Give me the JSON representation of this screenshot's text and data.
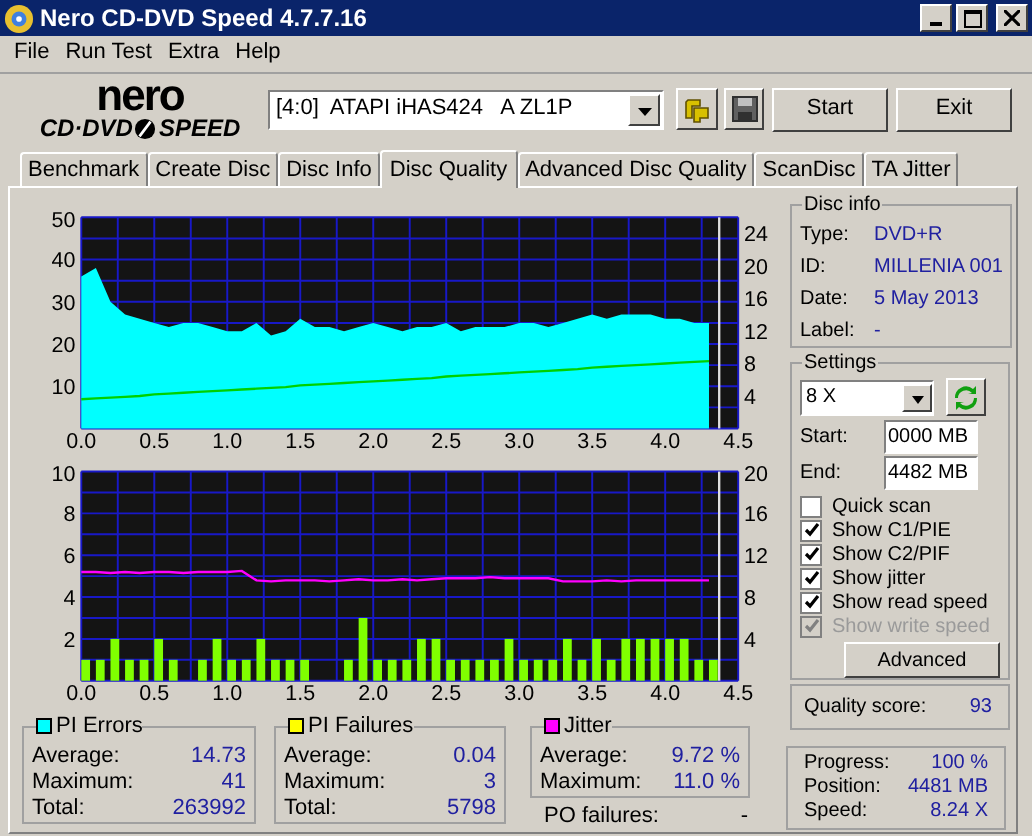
{
  "window": {
    "title": "Nero CD-DVD Speed 4.7.7.16"
  },
  "menu": [
    "File",
    "Run Test",
    "Extra",
    "Help"
  ],
  "logo": {
    "brand": "nero",
    "left": "CD·DVD",
    "right": "SPEED"
  },
  "drive": {
    "value": "[4:0]  ATAPI iHAS424   A ZL1P"
  },
  "buttons": [
    "Start",
    "Exit"
  ],
  "tabs": [
    {
      "label": "Benchmark",
      "selected": false
    },
    {
      "label": "Create Disc",
      "selected": false
    },
    {
      "label": "Disc Info",
      "selected": false
    },
    {
      "label": "Disc Quality",
      "selected": true
    },
    {
      "label": "Advanced Disc Quality",
      "selected": false
    },
    {
      "label": "ScanDisc",
      "selected": false
    },
    {
      "label": "TA Jitter",
      "selected": false
    }
  ],
  "charts": [
    {
      "chart_data": {
        "type": "area",
        "grid": true,
        "xlim": [
          0,
          4.5
        ],
        "ylim": [
          0,
          50
        ],
        "y2lim": [
          0,
          26
        ],
        "xticks": [
          {
            "value": 0,
            "label": "0.0"
          },
          {
            "value": 0.5,
            "label": "0.5"
          },
          {
            "value": 1,
            "label": "1.0"
          },
          {
            "value": 1.5,
            "label": "1.5"
          },
          {
            "value": 2,
            "label": "2.0"
          },
          {
            "value": 2.5,
            "label": "2.5"
          },
          {
            "value": 3,
            "label": "3.0"
          },
          {
            "value": 3.5,
            "label": "3.5"
          },
          {
            "value": 4,
            "label": "4.0"
          },
          {
            "value": 4.5,
            "label": "4.5"
          }
        ],
        "yticks": [
          10,
          20,
          30,
          40,
          50
        ],
        "y2ticks": [
          4,
          8,
          12,
          16,
          20,
          24
        ],
        "x": [
          0,
          0.1,
          0.2,
          0.3,
          0.4,
          0.5,
          0.6,
          0.7,
          0.8,
          0.9,
          1,
          1.1,
          1.2,
          1.3,
          1.4,
          1.5,
          1.6,
          1.7,
          1.8,
          1.9,
          2,
          2.1,
          2.2,
          2.3,
          2.4,
          2.5,
          2.6,
          2.7,
          2.8,
          2.9,
          3,
          3.1,
          3.2,
          3.3,
          3.4,
          3.5,
          3.6,
          3.7,
          3.8,
          3.9,
          4,
          4.1,
          4.2,
          4.3
        ],
        "series": [
          {
            "color": "#00ffff",
            "values": [
              36,
              38,
              30,
              27,
              26,
              25,
              24,
              25,
              25,
              24,
              23,
              23,
              25,
              22,
              23,
              26,
              24,
              24,
              23,
              24,
              25,
              24,
              23,
              24,
              24,
              25,
              23,
              24,
              24,
              24,
              25,
              25,
              24,
              25,
              26,
              27,
              26,
              27,
              27,
              27,
              26,
              26,
              25,
              25
            ]
          },
          {
            "color": "#00d000",
            "axis": "y2",
            "type": "line",
            "values": [
              3.6,
              3.7,
              3.8,
              3.9,
              4.0,
              4.2,
              4.3,
              4.4,
              4.5,
              4.6,
              4.7,
              4.8,
              4.9,
              5.0,
              5.1,
              5.3,
              5.4,
              5.5,
              5.6,
              5.7,
              5.8,
              5.9,
              6.0,
              6.1,
              6.2,
              6.4,
              6.5,
              6.6,
              6.7,
              6.8,
              6.9,
              7.0,
              7.1,
              7.2,
              7.3,
              7.5,
              7.6,
              7.7,
              7.8,
              7.9,
              8.0,
              8.1,
              8.2,
              8.3
            ]
          }
        ],
        "ref_lines": [
          {
            "axis": "x",
            "value": 4.37
          }
        ]
      }
    },
    {
      "chart_data": {
        "type": "bar",
        "grid": true,
        "xlim": [
          0,
          4.5
        ],
        "ylim": [
          0,
          10
        ],
        "y2lim": [
          0,
          20
        ],
        "xticks": [
          {
            "value": 0,
            "label": "0.0"
          },
          {
            "value": 0.5,
            "label": "0.5"
          },
          {
            "value": 1,
            "label": "1.0"
          },
          {
            "value": 1.5,
            "label": "1.5"
          },
          {
            "value": 2,
            "label": "2.0"
          },
          {
            "value": 2.5,
            "label": "2.5"
          },
          {
            "value": 3,
            "label": "3.0"
          },
          {
            "value": 3.5,
            "label": "3.5"
          },
          {
            "value": 4,
            "label": "4.0"
          },
          {
            "value": 4.5,
            "label": "4.5"
          }
        ],
        "yticks": [
          2,
          4,
          6,
          8,
          10
        ],
        "y2ticks": [
          4,
          8,
          12,
          16,
          20
        ],
        "x": [
          0,
          0.1,
          0.2,
          0.3,
          0.4,
          0.5,
          0.6,
          0.7,
          0.8,
          0.9,
          1,
          1.1,
          1.2,
          1.3,
          1.4,
          1.5,
          1.6,
          1.7,
          1.8,
          1.9,
          2,
          2.1,
          2.2,
          2.3,
          2.4,
          2.5,
          2.6,
          2.7,
          2.8,
          2.9,
          3,
          3.1,
          3.2,
          3.3,
          3.4,
          3.5,
          3.6,
          3.7,
          3.8,
          3.9,
          4,
          4.1,
          4.2,
          4.3
        ],
        "series": [
          {
            "color": "#80ff00",
            "values": [
              1,
              1,
              2,
              1,
              1,
              2,
              1,
              0,
              1,
              2,
              1,
              1,
              2,
              1,
              1,
              1,
              0,
              0,
              1,
              3,
              1,
              1,
              1,
              2,
              2,
              1,
              1,
              1,
              1,
              2,
              1,
              1,
              1,
              2,
              1,
              2,
              1,
              2,
              2,
              2,
              2,
              2,
              1,
              1
            ]
          },
          {
            "color": "#ff00ff",
            "axis": "y2",
            "type": "line",
            "values": [
              10.4,
              10.4,
              10.3,
              10.4,
              10.3,
              10.4,
              10.4,
              10.3,
              10.4,
              10.4,
              10.4,
              10.5,
              9.6,
              9.5,
              9.6,
              9.6,
              9.6,
              9.5,
              9.6,
              9.7,
              9.6,
              9.6,
              9.7,
              9.6,
              9.7,
              9.8,
              9.8,
              9.8,
              9.9,
              9.8,
              9.8,
              9.8,
              9.8,
              9.5,
              9.5,
              9.5,
              9.6,
              9.5,
              9.6,
              9.6,
              9.6,
              9.6,
              9.6,
              9.6
            ]
          }
        ],
        "ref_lines": [
          {
            "axis": "x",
            "value": 4.37
          }
        ]
      }
    }
  ],
  "disc_info": {
    "title": "Disc info",
    "rows": [
      {
        "label": "Type:",
        "value": "DVD+R"
      },
      {
        "label": "ID:",
        "value": "MILLENIA 001"
      },
      {
        "label": "Date:",
        "value": "5 May 2013"
      },
      {
        "label": "Label:",
        "value": "-"
      }
    ]
  },
  "settings": {
    "title": "Settings",
    "speed": "8 X",
    "start_label": "Start:",
    "start": "0000 MB",
    "end_label": "End:",
    "end": "4482 MB",
    "options": [
      {
        "label": "Quick scan",
        "checked": false,
        "disabled": false
      },
      {
        "label": "Show C1/PIE",
        "checked": true,
        "disabled": false
      },
      {
        "label": "Show C2/PIF",
        "checked": true,
        "disabled": false
      },
      {
        "label": "Show jitter",
        "checked": true,
        "disabled": false
      },
      {
        "label": "Show read speed",
        "checked": true,
        "disabled": false
      },
      {
        "label": "Show write speed",
        "checked": true,
        "disabled": true
      }
    ],
    "advanced": "Advanced"
  },
  "quality": {
    "label": "Quality score:",
    "value": "93"
  },
  "stats": [
    {
      "title": "PI Errors",
      "color": "#00ffff",
      "rows": [
        {
          "label": "Average:",
          "value": "14.73"
        },
        {
          "label": "Maximum:",
          "value": "41"
        },
        {
          "label": "Total:",
          "value": "263992"
        }
      ]
    },
    {
      "title": "PI Failures",
      "color": "#ffff00",
      "rows": [
        {
          "label": "Average:",
          "value": "0.04"
        },
        {
          "label": "Maximum:",
          "value": "3"
        },
        {
          "label": "Total:",
          "value": "5798"
        }
      ]
    },
    {
      "title": "Jitter",
      "color": "#ff00ff",
      "rows": [
        {
          "label": "Average:",
          "value": "9.72 %"
        },
        {
          "label": "Maximum:",
          "value": "11.0 %"
        }
      ]
    }
  ],
  "po_failures": {
    "label": "PO failures:",
    "value": "-"
  },
  "progress": [
    {
      "label": "Progress:",
      "value": "100 %"
    },
    {
      "label": "Position:",
      "value": "4481 MB"
    },
    {
      "label": "Speed:",
      "value": "8.24 X"
    }
  ]
}
